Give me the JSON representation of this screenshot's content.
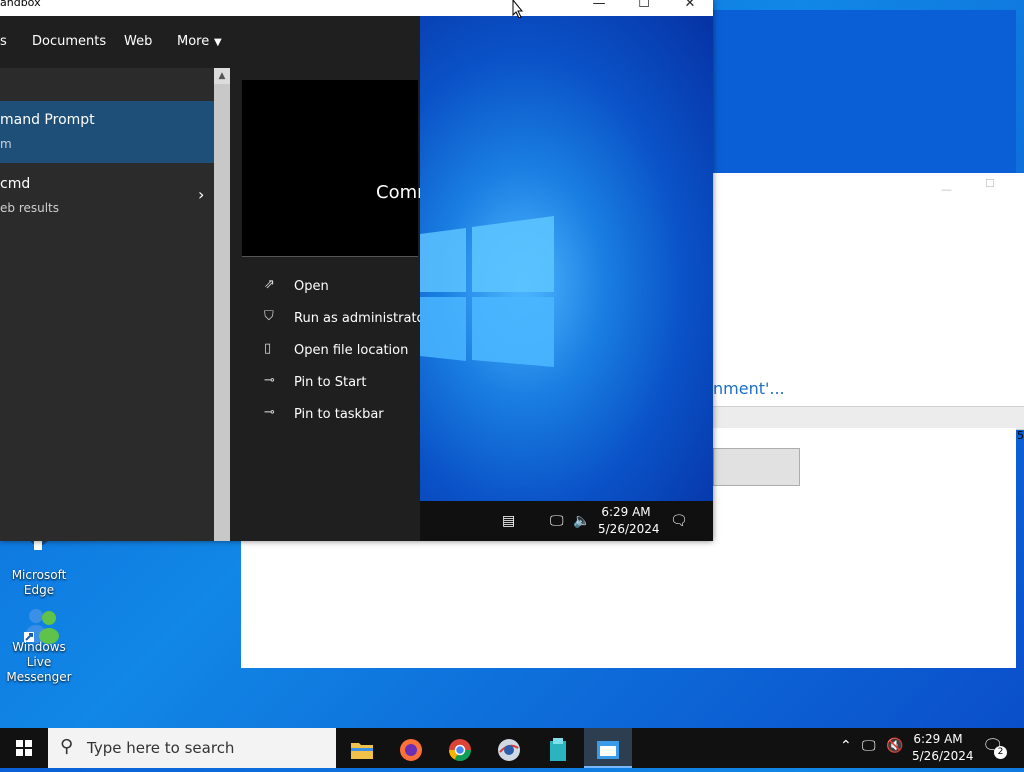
{
  "sandbox_window": {
    "title": "andbox",
    "minimize": "—",
    "maximize": "☐",
    "close": "✕"
  },
  "search_tabs": [
    "s",
    "Documents",
    "Web",
    "More"
  ],
  "results": [
    {
      "title": "mand Prompt",
      "subtitle": "m"
    },
    {
      "title": "cmd",
      "subtitle": "eb results"
    }
  ],
  "detail": {
    "name": "Comm",
    "actions": [
      "Open",
      "Run as administrator",
      "Open file location",
      "Pin to Start",
      "Pin to taskbar"
    ]
  },
  "inner_taskbar": {
    "time": "6:29 AM",
    "date": "5/26/2024"
  },
  "background_window": {
    "link_text": "nment'...",
    "side_text": "5"
  },
  "desktop_icons": [
    {
      "label": "Microsoft\nEdge"
    },
    {
      "label": "Windows Live\nMessenger"
    }
  ],
  "taskbar": {
    "search_placeholder": "Type here to search",
    "time": "6:29 AM",
    "date": "5/26/2024",
    "notification_count": "2",
    "apps": [
      "file-explorer",
      "firefox",
      "chrome",
      "app-4",
      "app-5",
      "windows-sandbox"
    ]
  },
  "colors": {
    "selected_result": "#1d4f78",
    "taskbar": "#111111",
    "accent": "#0a5fd6"
  }
}
